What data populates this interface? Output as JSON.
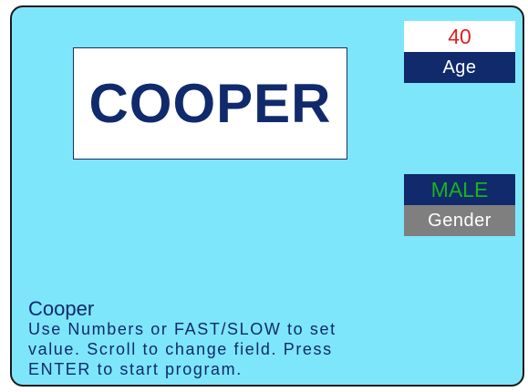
{
  "program": {
    "title_display": "COOPER",
    "name": "Cooper"
  },
  "fields": {
    "age": {
      "value": "40",
      "label": "Age",
      "value_color": "#e02020"
    },
    "gender": {
      "value": "MALE",
      "label": "Gender",
      "value_color": "#19b21f"
    }
  },
  "help": {
    "text": "Use Numbers or FAST/SLOW to set\nvalue.  Scroll to change field. Press\nENTER to start program."
  },
  "colors": {
    "background": "#7ee6fb",
    "primary": "#102a6b",
    "label_gray": "#7f7f7f"
  }
}
